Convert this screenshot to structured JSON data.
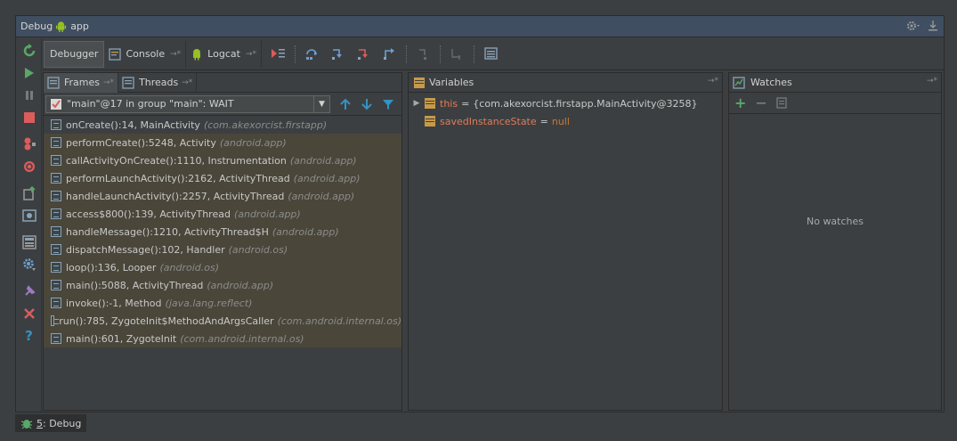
{
  "window": {
    "title_prefix": "Debug",
    "title_app": "app"
  },
  "toolbar": {
    "tabs": [
      {
        "label": "Debugger"
      },
      {
        "label": "Console"
      },
      {
        "label": "Logcat"
      }
    ]
  },
  "frames_panel": {
    "tabs": [
      {
        "label": "Frames"
      },
      {
        "label": "Threads"
      }
    ],
    "thread_selector": "\"main\"@17 in group \"main\": WAIT",
    "frames": [
      {
        "method": "onCreate():14, MainActivity",
        "package": "(com.akexorcist.firstapp)"
      },
      {
        "method": "performCreate():5248, Activity",
        "package": "(android.app)"
      },
      {
        "method": "callActivityOnCreate():1110, Instrumentation",
        "package": "(android.app)"
      },
      {
        "method": "performLaunchActivity():2162, ActivityThread",
        "package": "(android.app)"
      },
      {
        "method": "handleLaunchActivity():2257, ActivityThread",
        "package": "(android.app)"
      },
      {
        "method": "access$800():139, ActivityThread",
        "package": "(android.app)"
      },
      {
        "method": "handleMessage():1210, ActivityThread$H",
        "package": "(android.app)"
      },
      {
        "method": "dispatchMessage():102, Handler",
        "package": "(android.os)"
      },
      {
        "method": "loop():136, Looper",
        "package": "(android.os)"
      },
      {
        "method": "main():5088, ActivityThread",
        "package": "(android.app)"
      },
      {
        "method": "invoke():-1, Method",
        "package": "(java.lang.reflect)"
      },
      {
        "method": "run():785, ZygoteInit$MethodAndArgsCaller",
        "package": "(com.android.internal.os)"
      },
      {
        "method": "main():601, ZygoteInit",
        "package": "(com.android.internal.os)"
      }
    ]
  },
  "variables_panel": {
    "title": "Variables",
    "items": [
      {
        "name": "this",
        "eq": "=",
        "value": "{com.akexorcist.firstapp.MainActivity@3258}",
        "expandable": true
      },
      {
        "name": "savedInstanceState",
        "eq": "=",
        "value": "null",
        "expandable": false
      }
    ]
  },
  "watches_panel": {
    "title": "Watches",
    "empty_text": "No watches"
  },
  "bottom_tab": {
    "number": "5",
    "label": ": Debug"
  },
  "colors": {
    "background": "#3c3f41",
    "title_bar": "#3f4e60",
    "frame_highlight": "#4a463a",
    "var_name": "#e07b5a",
    "null_keyword": "#cc7832"
  }
}
